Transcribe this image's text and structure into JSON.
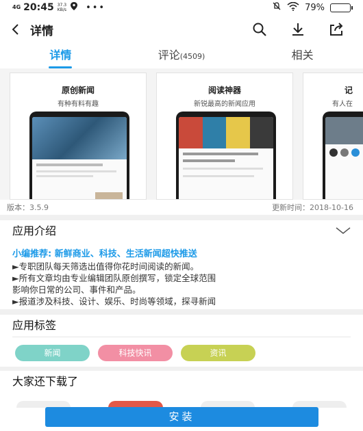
{
  "status": {
    "network": "4G",
    "time": "20:45",
    "speed_value": "37.3",
    "speed_unit": "KB/s",
    "battery": "79%",
    "battery_level": 0.79
  },
  "header": {
    "title": "详情"
  },
  "tabs": [
    {
      "label": "详情"
    },
    {
      "label": "评论",
      "count": "(4509)"
    },
    {
      "label": "相关"
    }
  ],
  "screenshots": [
    {
      "title": "原创新闻",
      "subtitle": "有种有料有趣"
    },
    {
      "title": "阅读神器",
      "subtitle": "新锐最高的新闻应用"
    },
    {
      "title": "记",
      "subtitle": "有人在"
    }
  ],
  "meta": {
    "version": "版本：3.5.9",
    "updated": "更新时间：2018-10-16"
  },
  "intro": {
    "title": "应用介绍",
    "lead": "小编推荐: 新鲜商业、科技、生活新闻超快推送",
    "lines": [
      "►专职团队每天筛选出值得你花时间阅读的新闻。",
      "►所有文章均由专业编辑团队原创撰写，锁定全球范围",
      "影响你日常的公司、事件和产品。",
      "►报道涉及科技、设计、娱乐、时尚等领域，探寻新闻"
    ]
  },
  "tags": {
    "title": "应用标签",
    "items": [
      {
        "label": "新闻",
        "color": "#7fd3c8"
      },
      {
        "label": "科技快讯",
        "color": "#f28fa4"
      },
      {
        "label": "资讯",
        "color": "#c7d154"
      }
    ]
  },
  "also": {
    "title": "大家还下载了"
  },
  "install": {
    "label": "安装"
  },
  "colors": {
    "accent": "#1c9ae8",
    "button": "#1d8be0"
  }
}
